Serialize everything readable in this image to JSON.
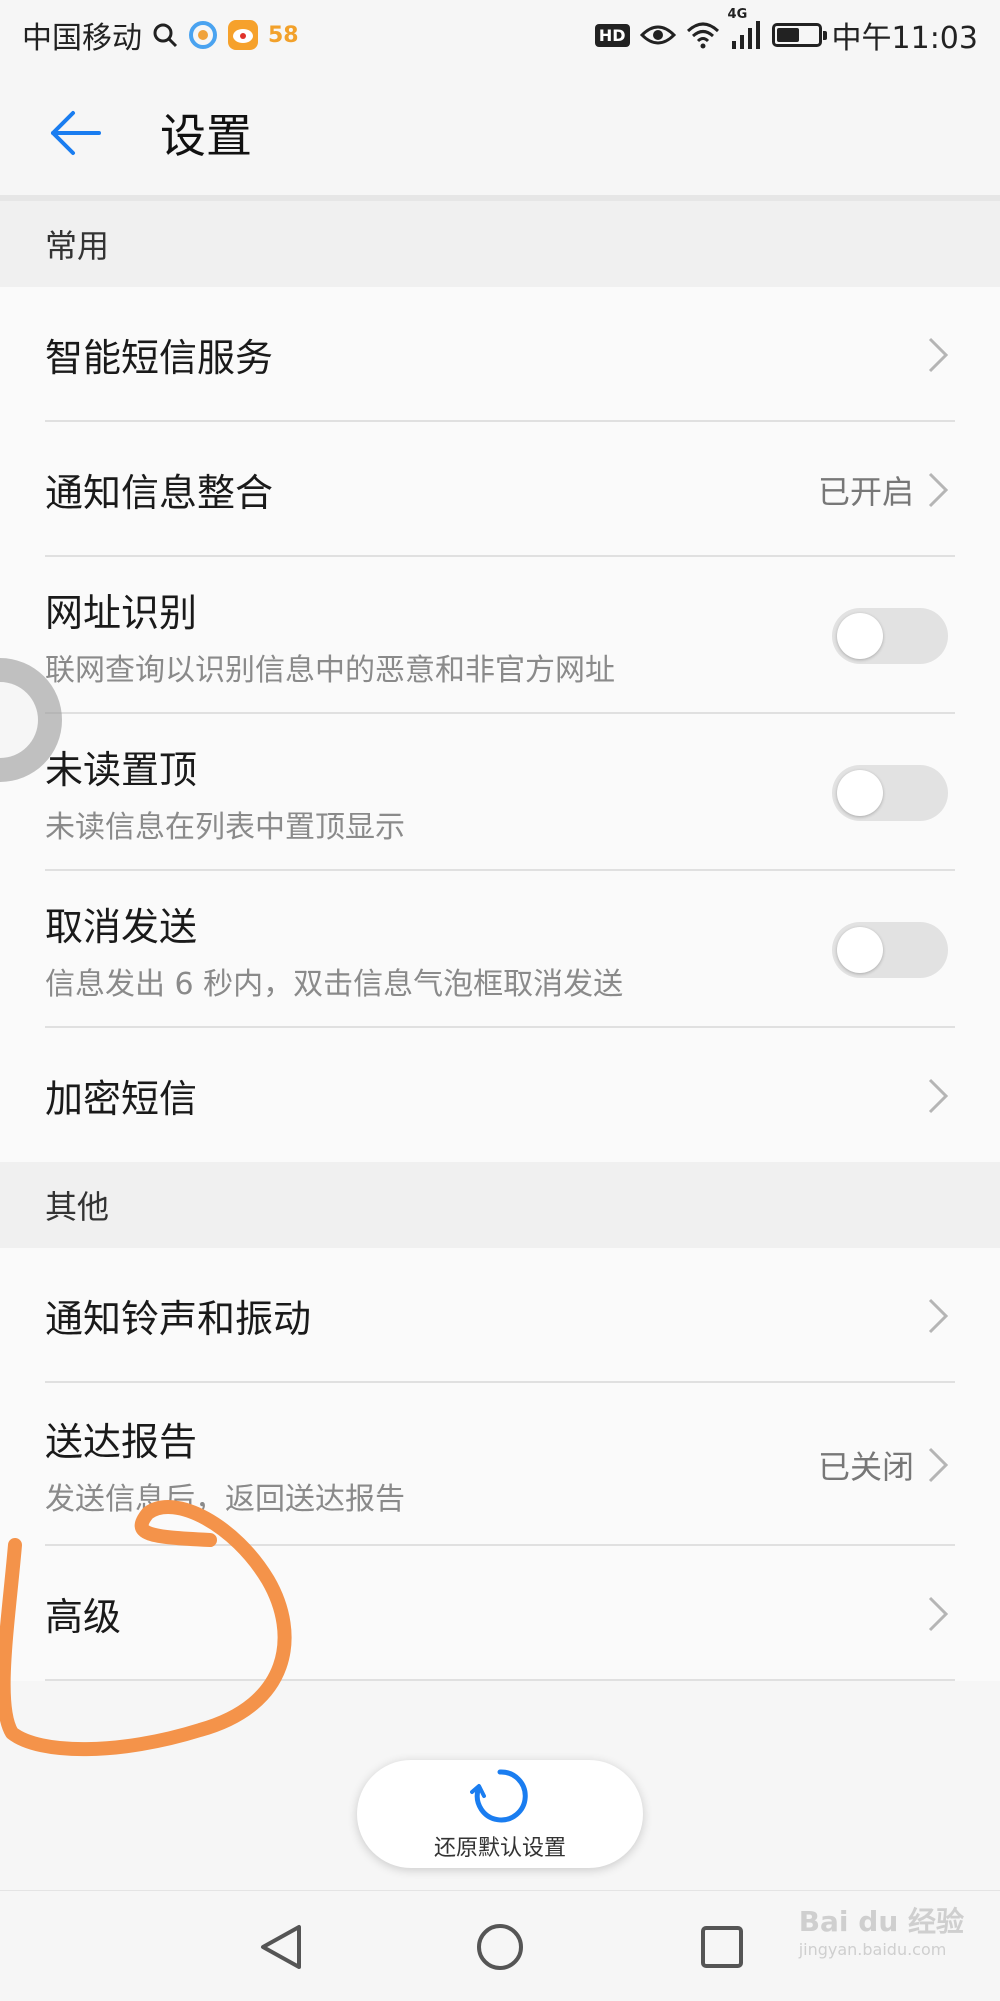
{
  "status_bar": {
    "carrier": "中国移动",
    "app_badges": [
      "58"
    ],
    "hd_label": "HD",
    "network": "4G",
    "time": "中午11:03",
    "battery_level": 0.55
  },
  "app_bar": {
    "title": "设置"
  },
  "sections": {
    "common": {
      "header": "常用",
      "items": [
        {
          "title": "智能短信服务"
        },
        {
          "title": "通知信息整合",
          "value": "已开启"
        },
        {
          "title": "网址识别",
          "subtitle": "联网查询以识别信息中的恶意和非官方网址",
          "toggle_on": false
        },
        {
          "title": "未读置顶",
          "subtitle": "未读信息在列表中置顶显示",
          "toggle_on": false
        },
        {
          "title": "取消发送",
          "subtitle": "信息发出 6 秒内，双击信息气泡框取消发送",
          "toggle_on": false
        },
        {
          "title": "加密短信"
        }
      ]
    },
    "other": {
      "header": "其他",
      "items": [
        {
          "title": "通知铃声和振动"
        },
        {
          "title": "送达报告",
          "subtitle": "发送信息后，返回送达报告",
          "value": "已关闭"
        },
        {
          "title": "高级"
        }
      ]
    }
  },
  "reset": {
    "label": "还原默认设置"
  },
  "watermark": {
    "brand": "Bai du 经验",
    "url": "jingyan.baidu.com"
  },
  "colors": {
    "accent": "#1a7df0",
    "annotation": "#f4934a"
  }
}
